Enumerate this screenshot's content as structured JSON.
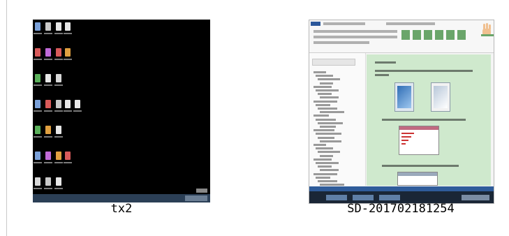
{
  "tiles": [
    {
      "label": "tx2"
    },
    {
      "label": "SD-201702181254"
    }
  ],
  "colors": {
    "desktop_bg": "#000000",
    "document_bg": "#cfe9cd",
    "accent_blue": "#2b579a"
  }
}
